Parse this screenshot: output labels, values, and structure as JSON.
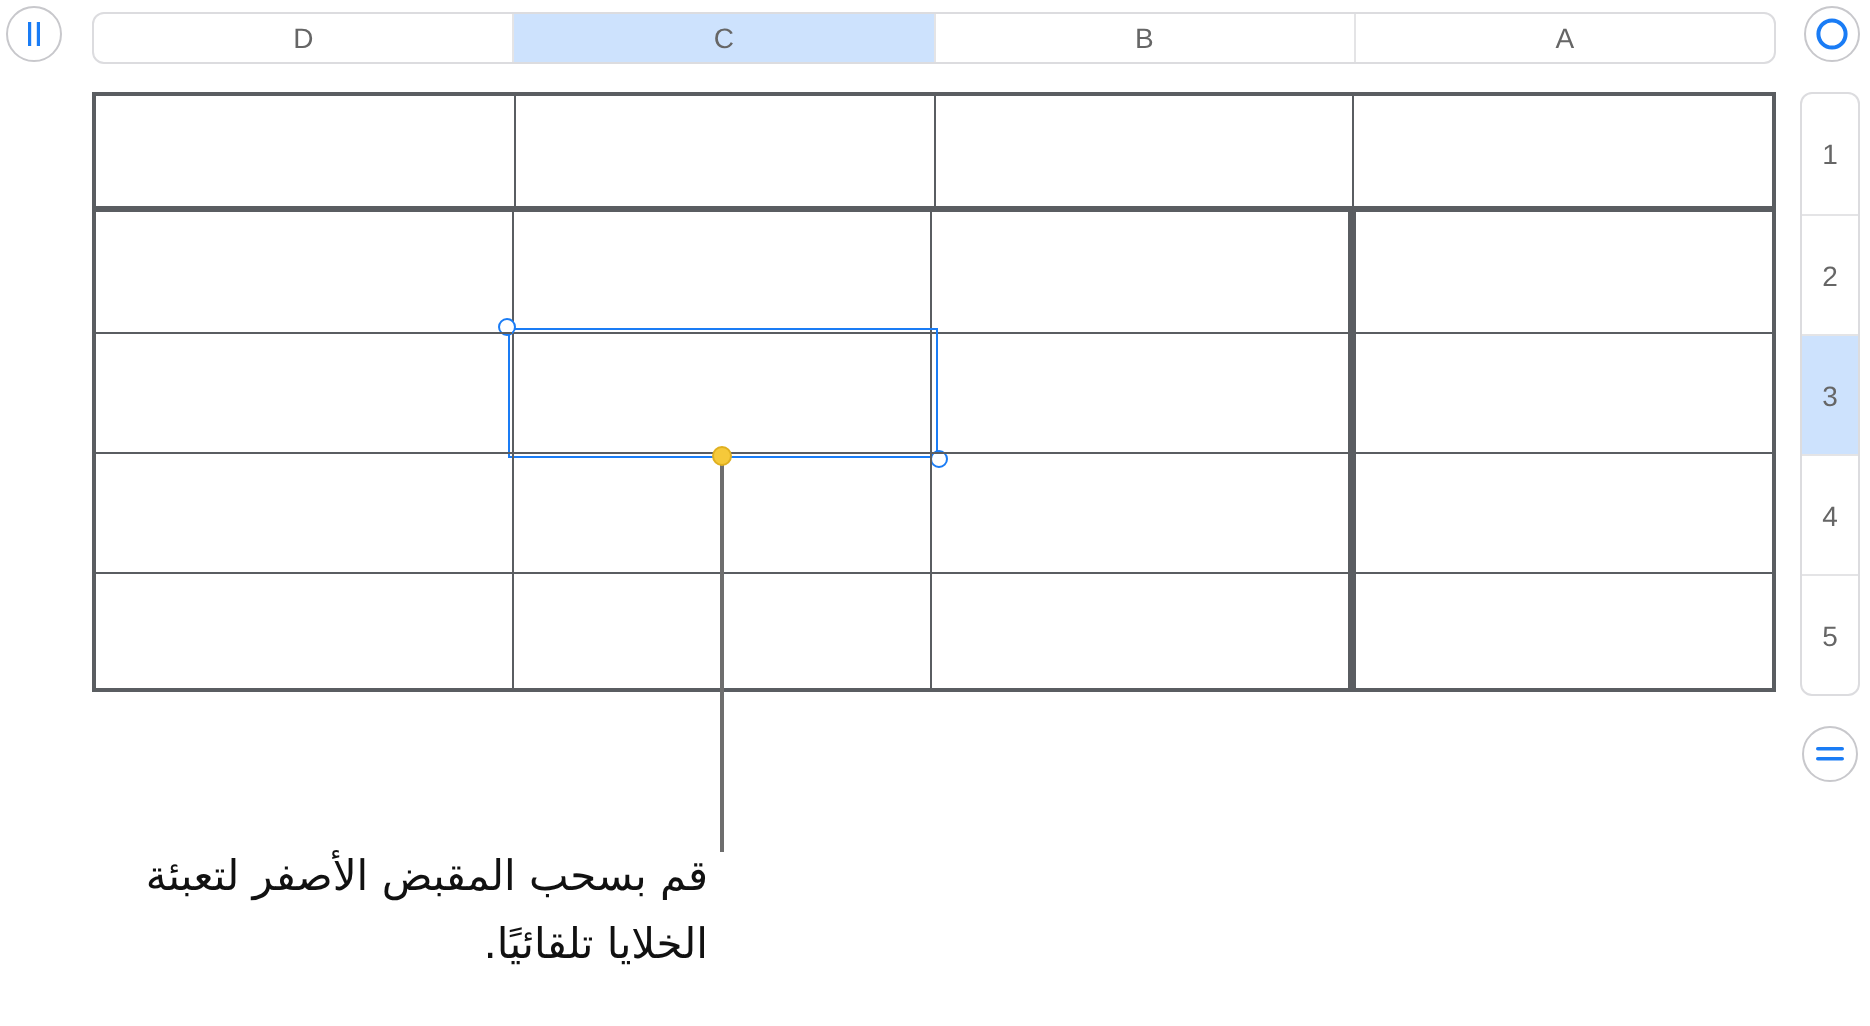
{
  "column_headers": [
    {
      "label": "A",
      "selected": false
    },
    {
      "label": "B",
      "selected": false
    },
    {
      "label": "C",
      "selected": true
    },
    {
      "label": "D",
      "selected": false
    }
  ],
  "row_headers": [
    {
      "label": "1",
      "selected": false
    },
    {
      "label": "2",
      "selected": false
    },
    {
      "label": "3",
      "selected": true
    },
    {
      "label": "4",
      "selected": false
    },
    {
      "label": "5",
      "selected": false
    }
  ],
  "callout": "قم بسحب المقبض الأصفر لتعبئة الخلايا تلقائيًا."
}
